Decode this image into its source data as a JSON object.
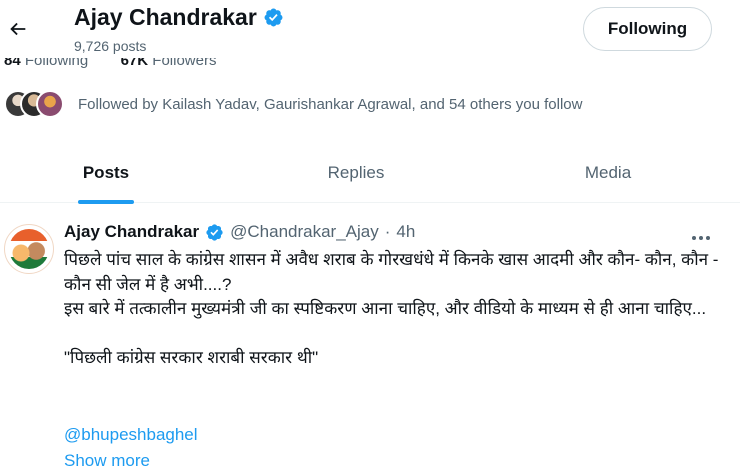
{
  "header": {
    "name": "Ajay Chandrakar",
    "posts_count": "9,726 posts",
    "follow_label": "Following"
  },
  "counts": {
    "following_number": "84",
    "following_label": "Following",
    "followers_number": "67K",
    "followers_label": "Followers"
  },
  "followed_by": {
    "text": "Followed by Kailash Yadav, Gaurishankar Agrawal, and 54 others you follow"
  },
  "tabs": [
    {
      "label": "Posts",
      "active": true
    },
    {
      "label": "Replies",
      "active": false
    },
    {
      "label": "Media",
      "active": false
    }
  ],
  "post": {
    "author_name": "Ajay Chandrakar",
    "handle": "@Chandrakar_Ajay",
    "separator": "·",
    "time": "4h",
    "body_line1": "पिछले पांच साल के कांग्रेस शासन में अवैध शराब के गोरखधंधे में किनके खास आदमी और कौन- कौन, कौन - कौन सी जेल में है अभी....?",
    "body_line2": "इस बारे में तत्कालीन मुख्यमंत्री जी का स्पष्टिकरण आना चाहिए, और वीडियो के माध्यम से ही आना चाहिए...",
    "body_quote": "\"पिछली कांग्रेस सरकार शराबी सरकार थी\"",
    "mention": "@bhupeshbaghel",
    "show_more": "Show more"
  },
  "colors": {
    "accent": "#1d9bf0",
    "secondary_text": "#536471",
    "verified_badge": "#1d9bf0"
  }
}
